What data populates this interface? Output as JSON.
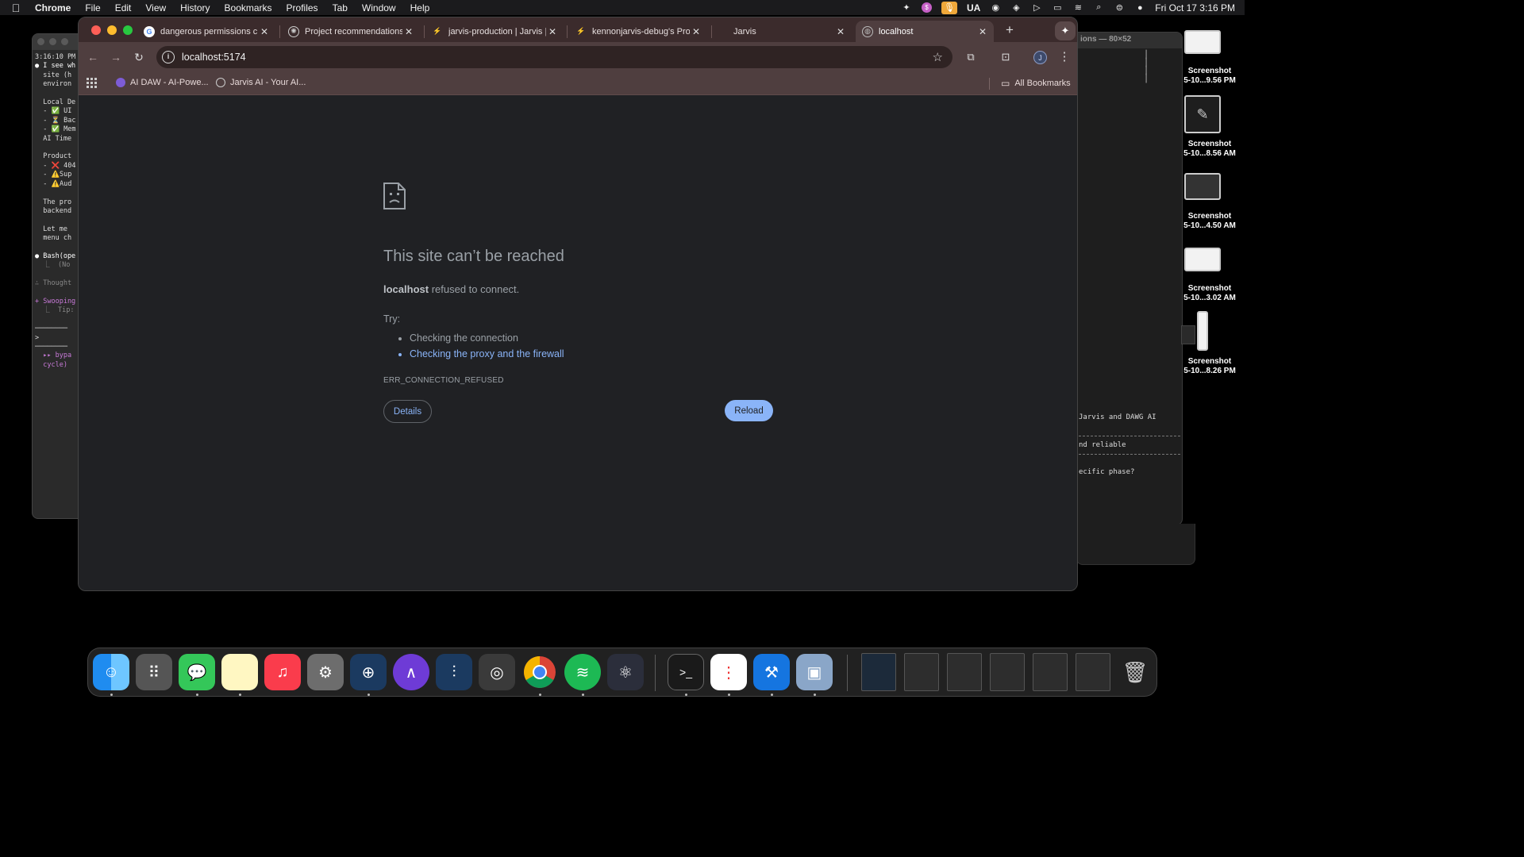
{
  "menubar": {
    "app_name": "Chrome",
    "menus": [
      "File",
      "Edit",
      "View",
      "History",
      "Bookmarks",
      "Profiles",
      "Tab",
      "Window",
      "Help"
    ],
    "input_source": "UA",
    "clock": "Fri Oct 17  3:16 PM"
  },
  "terminal_left": {
    "lines": [
      "3:16:10 PM",
      "● I see wh",
      "  site (h",
      "  environ",
      "",
      "  Local De",
      "  - ✅ UI",
      "  - ⏳ Bac",
      "  - ✅ Mem",
      "  AI Time",
      "",
      "  Product",
      "  - ❌ 404",
      "  - ⚠️Sup",
      "  - ⚠️Aud",
      "",
      "  The pro",
      "  backend",
      "",
      "  Let me",
      "  menu ch",
      "",
      "● Bash(ope",
      "  ⎿  (No",
      "",
      "∴ Thought",
      "",
      "+ Swooping",
      "  ⎿  Tip:",
      "",
      "────────",
      ">",
      "────────",
      "  ▸▸ bypa",
      "  cycle)"
    ]
  },
  "terminal_right": {
    "title": "ions — 80×52",
    "lines": [
      "Jarvis and DAWG AI",
      "nd reliable",
      "ecific phase?"
    ]
  },
  "desktop_files": [
    {
      "label": "Screenshot\n5-10...9.56 PM"
    },
    {
      "label": "Screenshot\n5-10...8.56 AM"
    },
    {
      "label": "Screenshot\n5-10...4.50 AM"
    },
    {
      "label": "Screenshot\n5-10...3.02 AM"
    },
    {
      "label": "Screenshot\n5-10...8.26 PM"
    }
  ],
  "tabs": [
    {
      "title": "dangerous permissions cla",
      "active": false
    },
    {
      "title": "Project recommendations",
      "active": false
    },
    {
      "title": "jarvis-production | Jarvis |",
      "active": false
    },
    {
      "title": "kennonjarvis-debug's Proj",
      "active": false
    },
    {
      "title": "Jarvis",
      "active": false
    },
    {
      "title": "localhost",
      "active": true
    }
  ],
  "address_bar": {
    "url": "localhost:5174"
  },
  "profile_initial": "J",
  "bookmarks": {
    "items": [
      {
        "label": "AI DAW - AI-Powe..."
      },
      {
        "label": "Jarvis AI - Your AI..."
      }
    ],
    "all_label": "All Bookmarks"
  },
  "error_page": {
    "title": "This site can’t be reached",
    "host": "localhost",
    "message_rest": "refused to connect.",
    "try_label": "Try:",
    "suggestions": [
      "Checking the connection",
      "Checking the proxy and the firewall"
    ],
    "error_code": "ERR_CONNECTION_REFUSED",
    "details_label": "Details",
    "reload_label": "Reload"
  },
  "colors": {
    "accent_link": "#8ab4f8",
    "tab_strip": "#3b2b2c",
    "toolbar": "#4f3e3f",
    "page_bg": "#202124"
  },
  "dock_apps": [
    "finder-icon",
    "launchpad-icon",
    "messages-icon",
    "notes-icon",
    "music-icon",
    "system-settings-icon",
    "ua-connect-icon",
    "arc-app-icon",
    "ua-mixer-icon",
    "compressor-icon",
    "chrome-icon",
    "spotify-icon",
    "electron-icon",
    "terminal-icon",
    "reminders-icon",
    "xcode-icon",
    "preview-icon",
    "trash-icon"
  ]
}
